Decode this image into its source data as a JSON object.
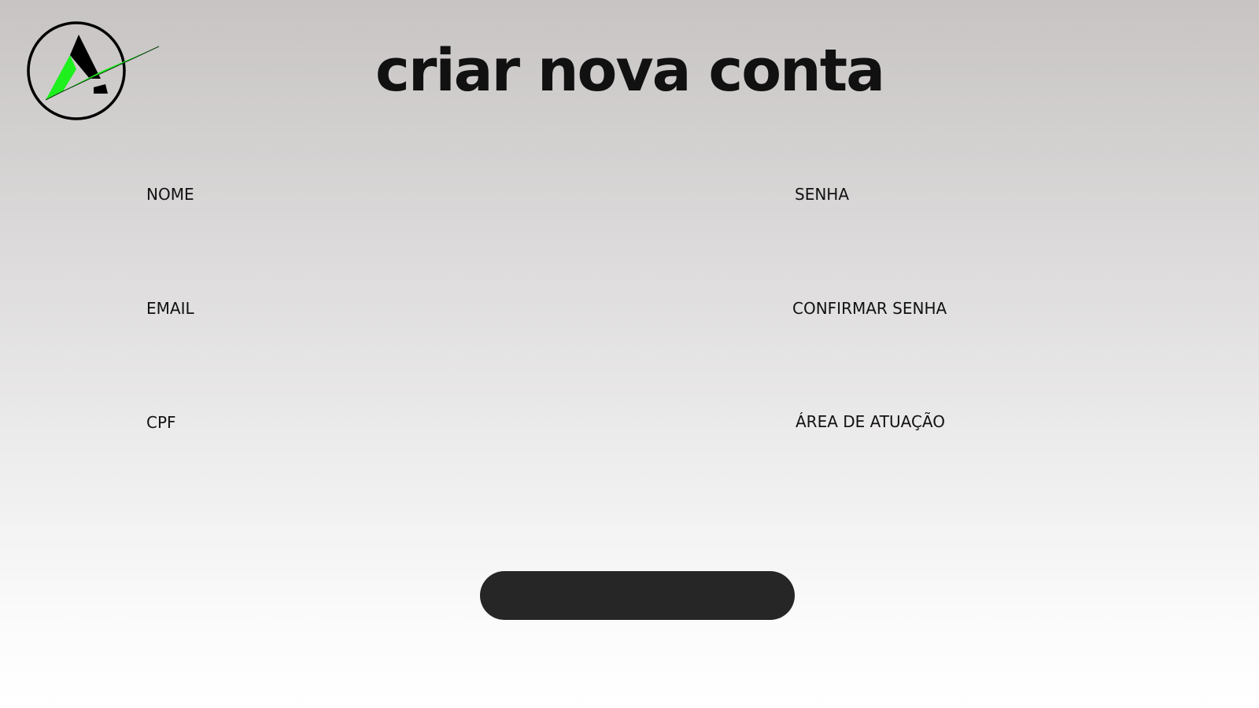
{
  "page": {
    "title": "criar nova conta"
  },
  "logo": {
    "icon": "brand-logo-icon",
    "accent_color": "#1ef01e",
    "ring_color": "#000000"
  },
  "form": {
    "nome": {
      "label": "NOME",
      "value": ""
    },
    "email": {
      "label": "EMAIL",
      "value": ""
    },
    "cpf": {
      "label": "CPF",
      "value": ""
    },
    "senha": {
      "label": "SENHA",
      "value": ""
    },
    "confirmar_senha": {
      "label": "CONFIRMAR SENHA",
      "value": ""
    },
    "area_atuacao": {
      "label": "ÁREA DE ATUAÇÃO",
      "value": ""
    },
    "submit": {
      "label": "",
      "color": "#262626"
    }
  }
}
